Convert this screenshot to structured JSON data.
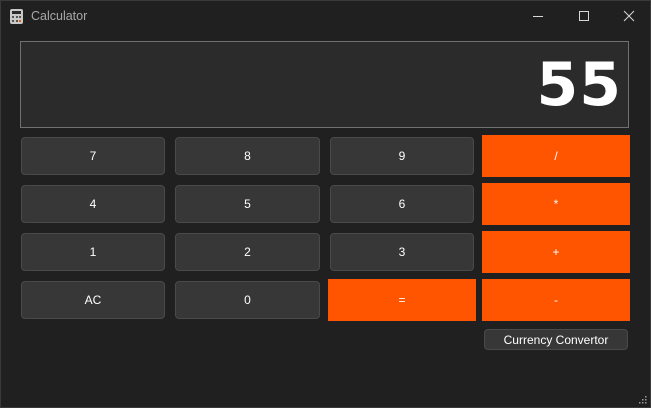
{
  "window": {
    "title": "Calculator",
    "icon": "calculator-icon",
    "controls": [
      "minimize-icon",
      "maximize-icon",
      "close-icon"
    ]
  },
  "display": {
    "value": "55"
  },
  "keys": {
    "k7": "7",
    "k8": "8",
    "k9": "9",
    "div": "/",
    "k4": "4",
    "k5": "5",
    "k6": "6",
    "mul": "*",
    "k1": "1",
    "k2": "2",
    "k3": "3",
    "add": "+",
    "ac": "AC",
    "k0": "0",
    "eq": "=",
    "sub": "-"
  },
  "currency_button": "Currency Convertor",
  "colors": {
    "background": "#202020",
    "key": "#373737",
    "accent": "#ff5500",
    "display": "#2b2b2b"
  }
}
